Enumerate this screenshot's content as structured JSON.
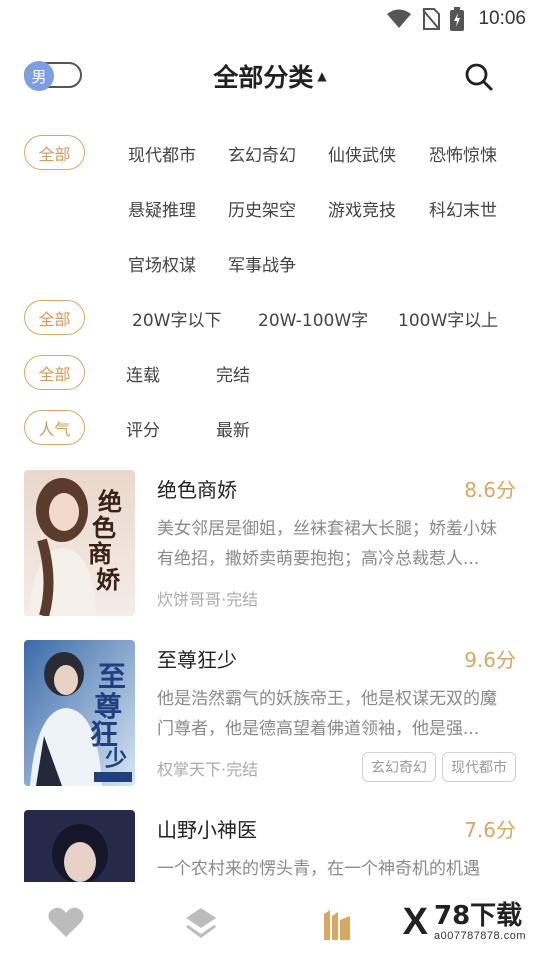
{
  "status_bar": {
    "time": "10:06"
  },
  "header": {
    "gender_label": "男",
    "title": "全部分类",
    "accent_color": "#d9a760"
  },
  "filters": {
    "category": {
      "selected": "全部",
      "options": [
        "现代都市",
        "玄幻奇幻",
        "仙侠武侠",
        "恐怖惊悚",
        "悬疑推理",
        "历史架空",
        "游戏竞技",
        "科幻末世",
        "官场权谋",
        "军事战争"
      ]
    },
    "word_count": {
      "selected": "全部",
      "options": [
        "20W字以下",
        "20W-100W字",
        "100W字以上"
      ]
    },
    "status": {
      "selected": "全部",
      "options": [
        "连载",
        "完结"
      ]
    },
    "sort": {
      "selected": "人气",
      "options": [
        "评分",
        "最新"
      ]
    }
  },
  "books": [
    {
      "title": "绝色商娇",
      "score": "8.6分",
      "desc": "美女邻居是御姐，丝袜套裙大长腿；娇羞小妹有绝招，撒娇卖萌要抱抱；高冷总裁惹人...",
      "meta": "炊饼哥哥·完结",
      "tags": [],
      "cover_text": "绝色商娇"
    },
    {
      "title": "至尊狂少",
      "score": "9.6分",
      "desc": "他是浩然霸气的妖族帝王，他是权谋无双的魔门尊者，他是德高望着佛道领袖，他是强...",
      "meta": "权掌天下·完结",
      "tags": [
        "玄幻奇幻",
        "现代都市"
      ],
      "cover_text": "至尊狂少"
    },
    {
      "title": "山野小神医",
      "score": "7.6分",
      "desc": "一个农村来的愣头青，在一个神奇机的机遇",
      "meta": "",
      "tags": [],
      "cover_text": ""
    }
  ],
  "watermark": {
    "logo": "X",
    "name": "78下载",
    "url": "a007787878.com"
  }
}
